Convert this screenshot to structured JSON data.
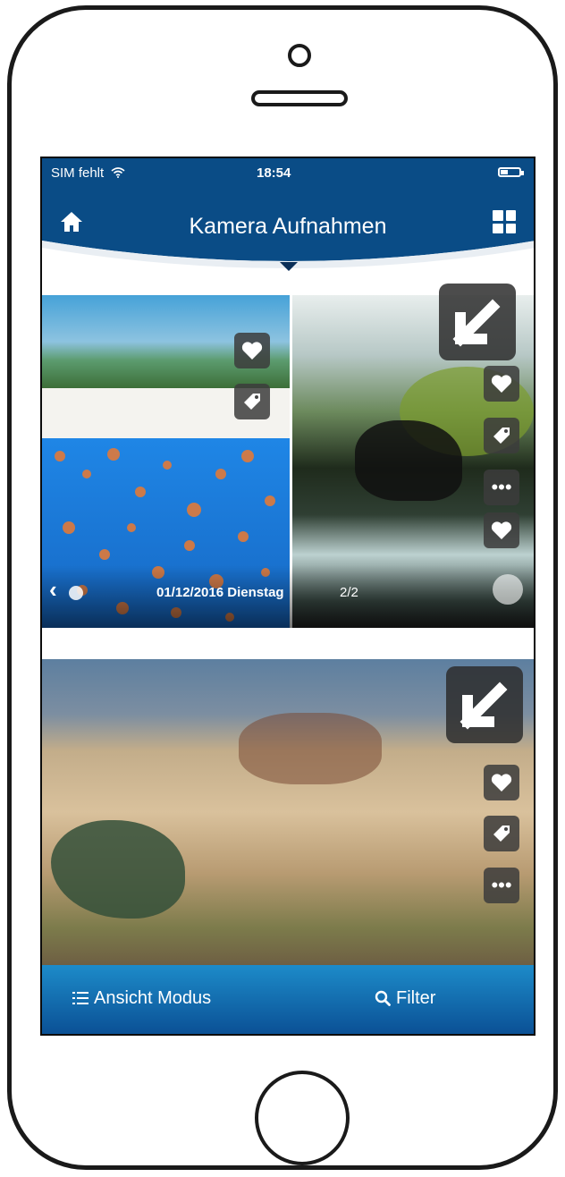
{
  "status_bar": {
    "carrier": "SIM fehlt",
    "time": "18:54"
  },
  "header": {
    "title": "Kamera Aufnahmen"
  },
  "gallery": {
    "caption_date": "01/12/2016 Dienstag",
    "caption_count": "2/2"
  },
  "bottom_bar": {
    "view_mode_label": "Ansicht Modus",
    "filter_label": "Filter"
  },
  "colors": {
    "header_blue": "#0a4c86",
    "bar_top": "#1d8bc9",
    "bar_bottom": "#0a4f94"
  },
  "icons": [
    "home-icon",
    "grid-icon",
    "heart-icon",
    "tag-icon",
    "more-icon",
    "expand-icon",
    "list-icon",
    "search-icon",
    "wifi-icon",
    "battery-icon"
  ]
}
